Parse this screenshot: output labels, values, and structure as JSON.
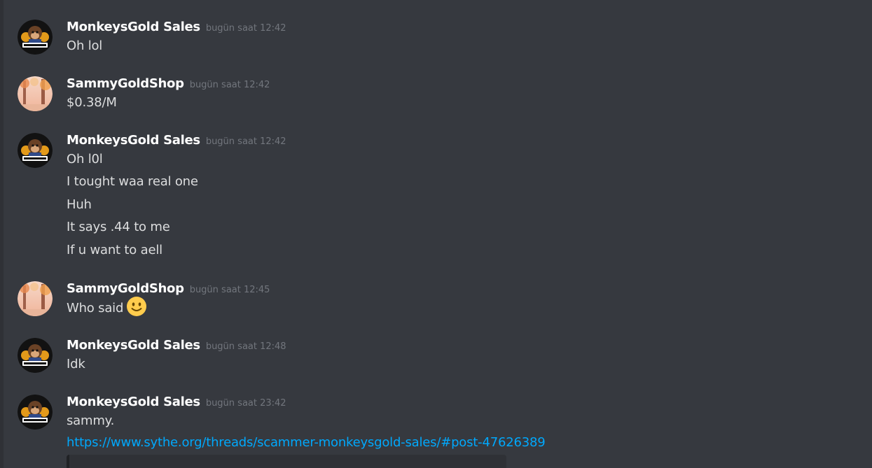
{
  "messages": [
    {
      "user": "MonkeysGold Sales",
      "time": "bugün saat 12:42",
      "lines": [
        "Oh lol"
      ]
    },
    {
      "user": "SammyGoldShop",
      "time": "bugün saat 12:42",
      "lines": [
        "$0.38/M"
      ]
    },
    {
      "user": "MonkeysGold Sales",
      "time": "bugün saat 12:42",
      "lines": [
        "Oh l0l",
        "I tought waa real one",
        "Huh",
        "It says .44 to me",
        "If u want to aell"
      ]
    },
    {
      "user": "SammyGoldShop",
      "time": "bugün saat 12:45",
      "lines": [
        "Who said"
      ],
      "emoji": "slightly-smiling-face-emoji"
    },
    {
      "user": "MonkeysGold Sales",
      "time": "bugün saat 12:48",
      "lines": [
        "Idk"
      ]
    },
    {
      "user": "MonkeysGold Sales",
      "time": "bugün saat 23:42",
      "lines": [
        "sammy."
      ],
      "link": "https://www.sythe.org/threads/scammer-monkeysgold-sales/#post-47626389"
    }
  ],
  "avatars": {
    "monkeysgold": {
      "icon": "monkeysgold-logo-avatar",
      "badge_text": "MONKEYSGOLD"
    },
    "sammygoldshop": {
      "icon": "autumn-forest-avatar"
    }
  },
  "colors": {
    "background": "#36393f",
    "username": "#ffffff",
    "message_text": "#dcddde",
    "timestamp": "#72767d",
    "link": "#00a8fc"
  }
}
